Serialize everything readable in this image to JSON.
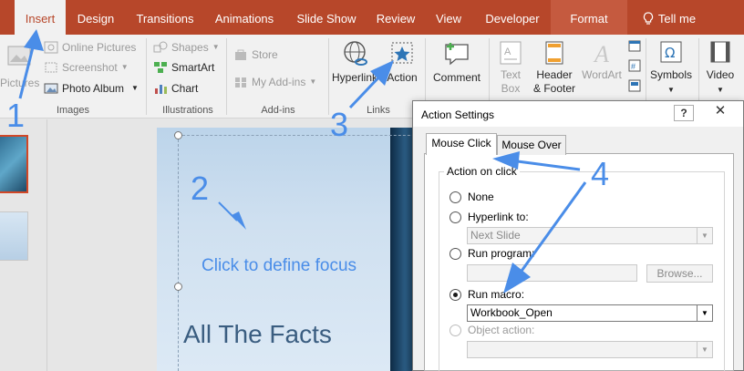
{
  "ribbon_tabs": [
    {
      "label": "Insert",
      "active": true
    },
    {
      "label": "Design"
    },
    {
      "label": "Transitions"
    },
    {
      "label": "Animations"
    },
    {
      "label": "Slide Show"
    },
    {
      "label": "Review"
    },
    {
      "label": "View"
    },
    {
      "label": "Developer"
    },
    {
      "label": "Format",
      "contextual": true
    },
    {
      "label": "Tell me",
      "icon": "lightbulb-icon"
    }
  ],
  "groups": {
    "images": {
      "label": "Images",
      "pictures": "Pictures",
      "online_pictures": "Online Pictures",
      "screenshot": "Screenshot",
      "photo_album": "Photo Album"
    },
    "illustrations": {
      "label": "Illustrations",
      "shapes": "Shapes",
      "smartart": "SmartArt",
      "chart": "Chart"
    },
    "addins": {
      "label": "Add-ins",
      "store": "Store",
      "my_addins": "My Add-ins"
    },
    "links": {
      "label": "Links",
      "hyperlink": "Hyperlink",
      "action": "Action"
    },
    "comments": {
      "comment": "Comment"
    },
    "text": {
      "text_box_1": "Text",
      "text_box_2": "Box",
      "header_footer_1": "Header",
      "header_footer_2": "& Footer",
      "wordart": "WordArt"
    },
    "symbols": {
      "symbols": "Symbols"
    },
    "media": {
      "video": "Video"
    }
  },
  "slide": {
    "title": "All The Facts",
    "annotation_text": "Click to define focus"
  },
  "dialog": {
    "title": "Action Settings",
    "help": "?",
    "close": "✕",
    "tabs": [
      "Mouse Click",
      "Mouse Over"
    ],
    "group_label": "Action on click",
    "options": {
      "none": "None",
      "hyperlink": "Hyperlink to:",
      "run_program": "Run program:",
      "run_macro": "Run macro:",
      "object_action": "Object action:"
    },
    "hyperlink_value": "Next Slide",
    "browse": "Browse...",
    "macro_value": "Workbook_Open",
    "selected": "run_macro"
  },
  "annotations": [
    "1",
    "2",
    "3",
    "4"
  ],
  "colors": {
    "accent": "#b7472a",
    "annotation": "#4a8de8"
  }
}
